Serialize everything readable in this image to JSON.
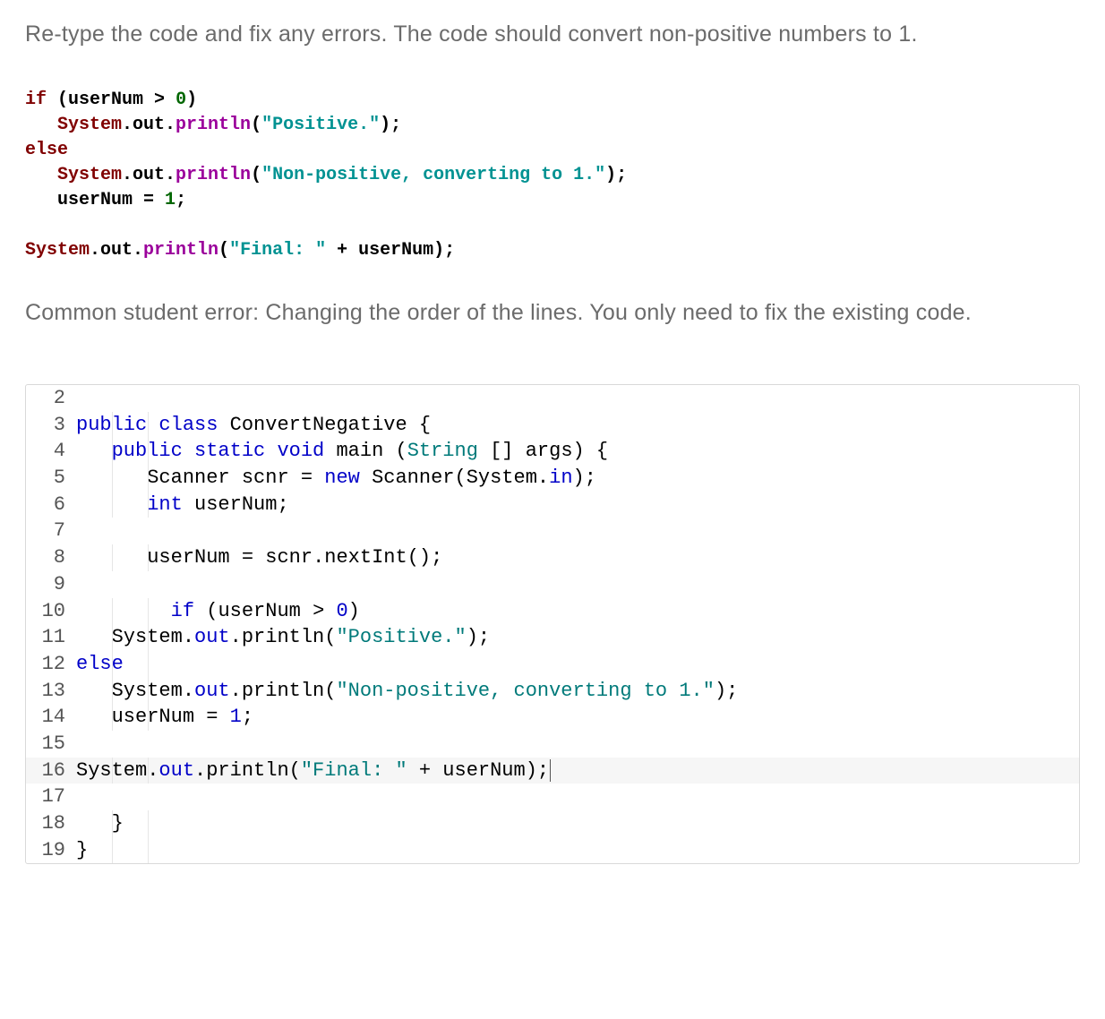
{
  "instruction": "Re-type the code and fix any errors. The code should convert non-positive numbers to 1.",
  "code_sample": {
    "line1": {
      "kw_if": "if",
      "paren_open": " (",
      "var": "userNum ",
      "op": "> ",
      "num": "0",
      "paren_close": ")"
    },
    "line2": {
      "indent": "   ",
      "classref": "System",
      "dot_out": ".out.",
      "method": "println",
      "open": "(",
      "str": "\"Positive.\"",
      "close": ");"
    },
    "line3": {
      "kw_else": "else"
    },
    "line4": {
      "indent": "   ",
      "classref": "System",
      "dot_out": ".out.",
      "method": "println",
      "open": "(",
      "str": "\"Non-positive, converting to 1.\"",
      "close": ");"
    },
    "line5": {
      "indent": "   ",
      "var": "userNum ",
      "eq": "= ",
      "num": "1",
      "semi": ";"
    },
    "line6": {
      "classref": "System",
      "dot_out": ".out.",
      "method": "println",
      "open": "(",
      "str": "\"Final: \"",
      "plus": " + userNum",
      "close": ");"
    }
  },
  "hint": "Common student error: Changing the order of the lines. You only need to fix the existing code.",
  "editor": {
    "lines": [
      {
        "num": "2",
        "raw": ""
      },
      {
        "num": "3",
        "tokens": [
          {
            "cls": "ekw",
            "t": "public"
          },
          {
            "cls": "epunct",
            "t": " "
          },
          {
            "cls": "ekw",
            "t": "class"
          },
          {
            "cls": "epunct",
            "t": " "
          },
          {
            "cls": "eid",
            "t": "ConvertNegative"
          },
          {
            "cls": "epunct",
            "t": " {"
          }
        ]
      },
      {
        "num": "4",
        "tokens": [
          {
            "cls": "epunct",
            "t": "   "
          },
          {
            "cls": "ekw",
            "t": "public"
          },
          {
            "cls": "epunct",
            "t": " "
          },
          {
            "cls": "ekw",
            "t": "static"
          },
          {
            "cls": "epunct",
            "t": " "
          },
          {
            "cls": "ekw",
            "t": "void"
          },
          {
            "cls": "epunct",
            "t": " "
          },
          {
            "cls": "eid",
            "t": "main"
          },
          {
            "cls": "epunct",
            "t": " ("
          },
          {
            "cls": "etype",
            "t": "String"
          },
          {
            "cls": "epunct",
            "t": " [] "
          },
          {
            "cls": "eid",
            "t": "args"
          },
          {
            "cls": "epunct",
            "t": ") {"
          }
        ]
      },
      {
        "num": "5",
        "tokens": [
          {
            "cls": "epunct",
            "t": "      "
          },
          {
            "cls": "eid",
            "t": "Scanner scnr "
          },
          {
            "cls": "epunct",
            "t": "= "
          },
          {
            "cls": "ekw",
            "t": "new"
          },
          {
            "cls": "epunct",
            "t": " "
          },
          {
            "cls": "eid",
            "t": "Scanner"
          },
          {
            "cls": "epunct",
            "t": "("
          },
          {
            "cls": "eid",
            "t": "System"
          },
          {
            "cls": "epunct",
            "t": "."
          },
          {
            "cls": "efield",
            "t": "in"
          },
          {
            "cls": "epunct",
            "t": ");"
          }
        ]
      },
      {
        "num": "6",
        "tokens": [
          {
            "cls": "epunct",
            "t": "      "
          },
          {
            "cls": "ekw",
            "t": "int"
          },
          {
            "cls": "epunct",
            "t": " "
          },
          {
            "cls": "eid",
            "t": "userNum"
          },
          {
            "cls": "epunct",
            "t": ";"
          }
        ]
      },
      {
        "num": "7",
        "raw": ""
      },
      {
        "num": "8",
        "tokens": [
          {
            "cls": "epunct",
            "t": "      "
          },
          {
            "cls": "eid",
            "t": "userNum "
          },
          {
            "cls": "epunct",
            "t": "= "
          },
          {
            "cls": "eid",
            "t": "scnr"
          },
          {
            "cls": "epunct",
            "t": "."
          },
          {
            "cls": "eid",
            "t": "nextInt"
          },
          {
            "cls": "epunct",
            "t": "();"
          }
        ]
      },
      {
        "num": "9",
        "raw": ""
      },
      {
        "num": "10",
        "tokens": [
          {
            "cls": "epunct",
            "t": "        "
          },
          {
            "cls": "ekw",
            "t": "if"
          },
          {
            "cls": "epunct",
            "t": " ("
          },
          {
            "cls": "eid",
            "t": "userNum "
          },
          {
            "cls": "epunct",
            "t": "> "
          },
          {
            "cls": "enum",
            "t": "0"
          },
          {
            "cls": "epunct",
            "t": ")"
          }
        ]
      },
      {
        "num": "11",
        "tokens": [
          {
            "cls": "epunct",
            "t": "   "
          },
          {
            "cls": "eid",
            "t": "System"
          },
          {
            "cls": "epunct",
            "t": "."
          },
          {
            "cls": "efield",
            "t": "out"
          },
          {
            "cls": "epunct",
            "t": "."
          },
          {
            "cls": "eid",
            "t": "println"
          },
          {
            "cls": "epunct",
            "t": "("
          },
          {
            "cls": "estr",
            "t": "\"Positive.\""
          },
          {
            "cls": "epunct",
            "t": ");"
          }
        ]
      },
      {
        "num": "12",
        "tokens": [
          {
            "cls": "ekw",
            "t": "else"
          }
        ]
      },
      {
        "num": "13",
        "tokens": [
          {
            "cls": "epunct",
            "t": "   "
          },
          {
            "cls": "eid",
            "t": "System"
          },
          {
            "cls": "epunct",
            "t": "."
          },
          {
            "cls": "efield",
            "t": "out"
          },
          {
            "cls": "epunct",
            "t": "."
          },
          {
            "cls": "eid",
            "t": "println"
          },
          {
            "cls": "epunct",
            "t": "("
          },
          {
            "cls": "estr",
            "t": "\"Non-positive, converting to 1.\""
          },
          {
            "cls": "epunct",
            "t": ");"
          }
        ]
      },
      {
        "num": "14",
        "tokens": [
          {
            "cls": "epunct",
            "t": "   "
          },
          {
            "cls": "eid",
            "t": "userNum "
          },
          {
            "cls": "epunct",
            "t": "= "
          },
          {
            "cls": "enum",
            "t": "1"
          },
          {
            "cls": "epunct",
            "t": ";"
          }
        ]
      },
      {
        "num": "15",
        "raw": ""
      },
      {
        "num": "16",
        "highlight": true,
        "cursor": true,
        "tokens": [
          {
            "cls": "eid",
            "t": "System"
          },
          {
            "cls": "epunct",
            "t": "."
          },
          {
            "cls": "efield",
            "t": "out"
          },
          {
            "cls": "epunct",
            "t": "."
          },
          {
            "cls": "eid",
            "t": "println"
          },
          {
            "cls": "epunct",
            "t": "("
          },
          {
            "cls": "estr",
            "t": "\"Final: \""
          },
          {
            "cls": "epunct",
            "t": " + "
          },
          {
            "cls": "eid",
            "t": "userNum"
          },
          {
            "cls": "epunct",
            "t": ");"
          }
        ]
      },
      {
        "num": "17",
        "raw": ""
      },
      {
        "num": "18",
        "tokens": [
          {
            "cls": "epunct",
            "t": "   }"
          }
        ]
      },
      {
        "num": "19",
        "tokens": [
          {
            "cls": "epunct",
            "t": "}"
          }
        ]
      }
    ]
  }
}
